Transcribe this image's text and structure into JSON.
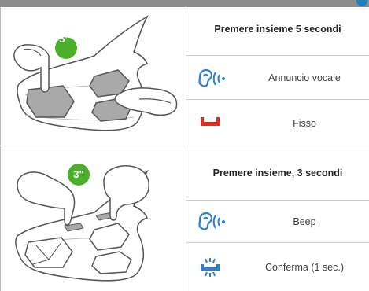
{
  "colors": {
    "header_bar": "#8c8c8c",
    "info_dot": "#1f7fc4",
    "badge_green": "#4caf2c",
    "icon_blue": "#2a7fd0",
    "icon_red": "#e32a1e",
    "pad_gray": "#a9a9a9"
  },
  "sections": [
    {
      "badge": "5\"",
      "heading": "Premere insieme 5 secondi",
      "rows": [
        {
          "icon": "ear-sound-icon",
          "label": "Annuncio vocale"
        },
        {
          "icon": "red-led-icon",
          "label": "Fisso"
        }
      ]
    },
    {
      "badge": "3\"",
      "heading": "Premere insieme, 3 secondi",
      "rows": [
        {
          "icon": "ear-sound-icon",
          "label": "Beep"
        },
        {
          "icon": "blue-led-blink-icon",
          "label": "Conferma (1 sec.)"
        }
      ]
    }
  ]
}
